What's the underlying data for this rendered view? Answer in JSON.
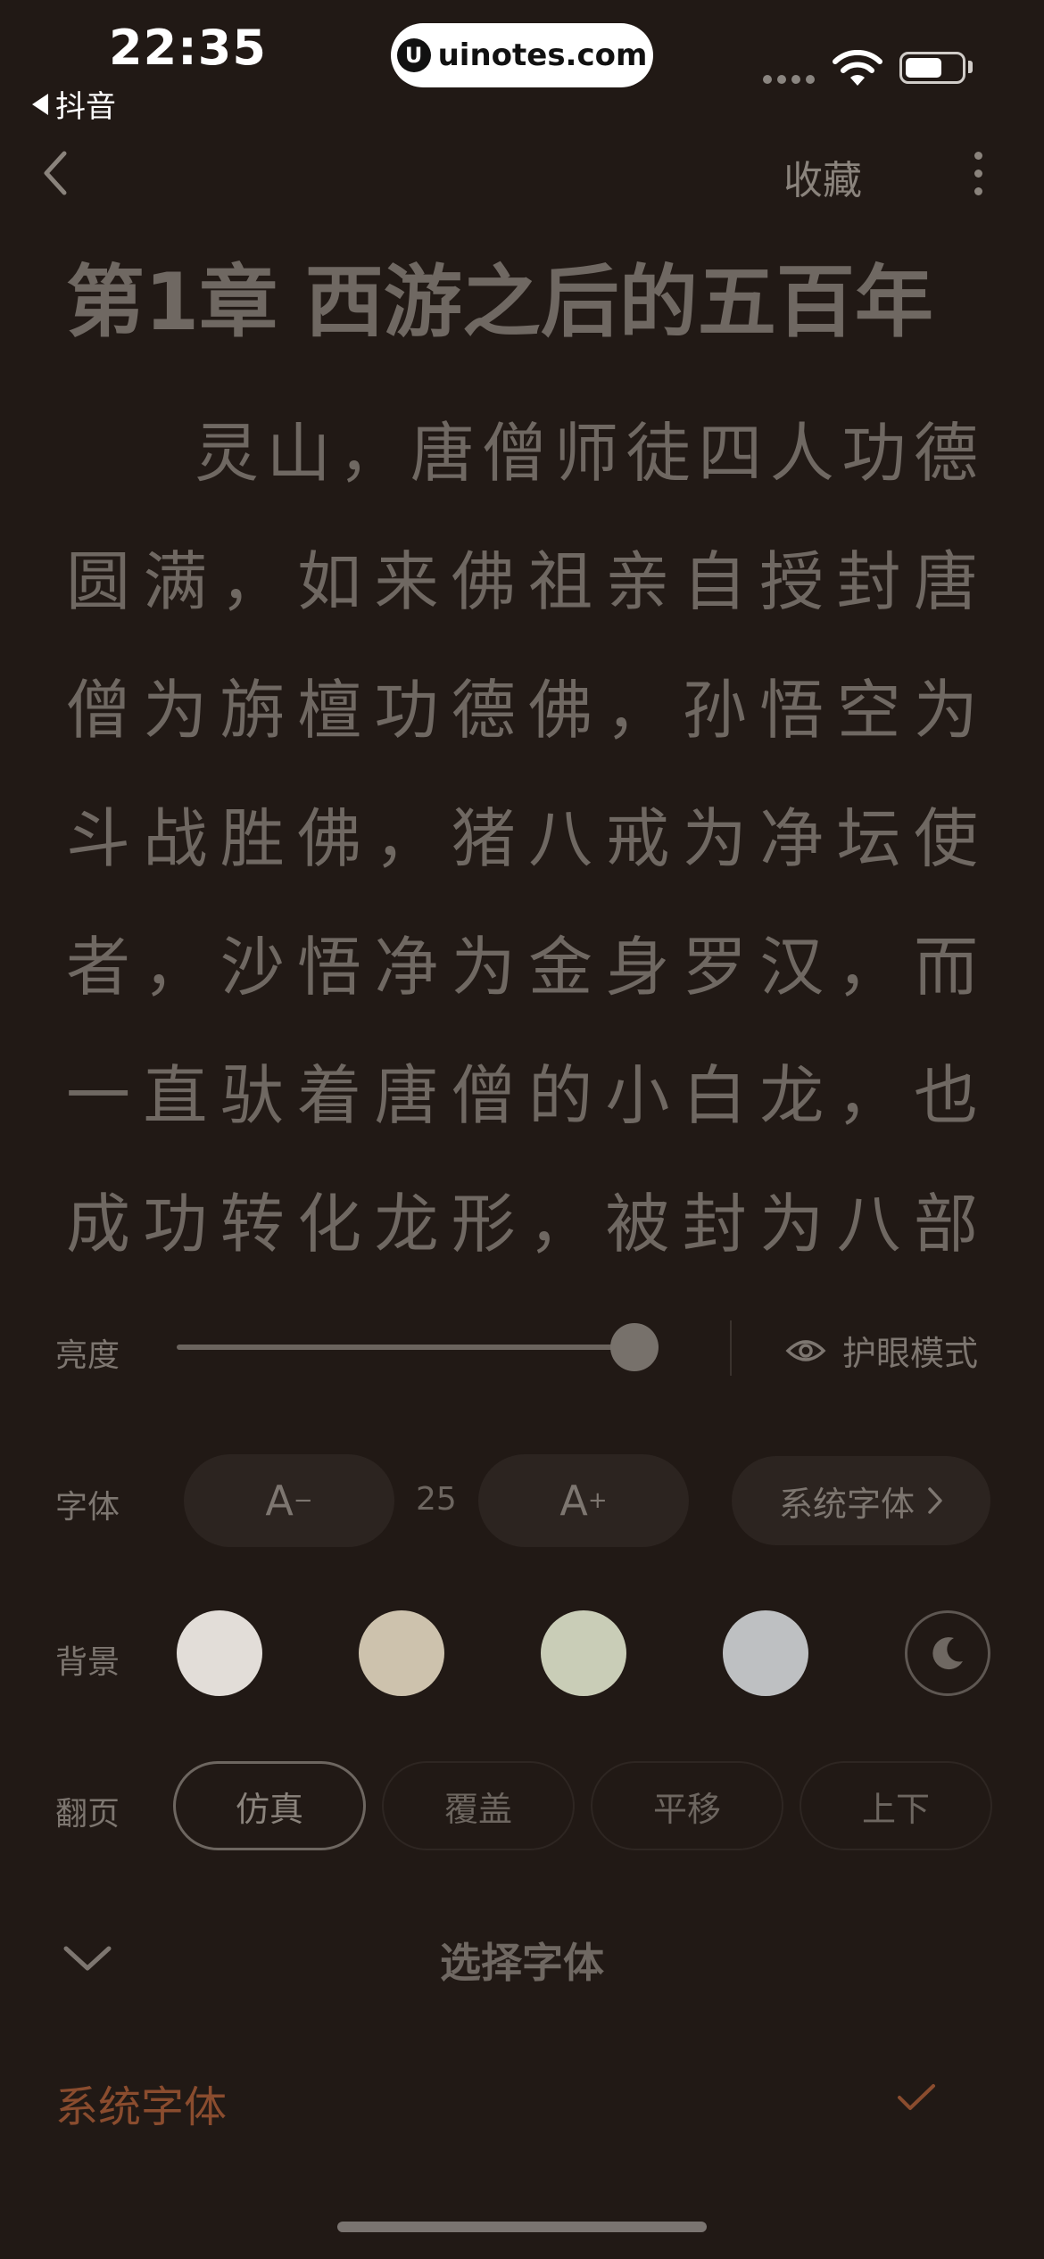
{
  "status_bar": {
    "time": "22:35",
    "back_app": "抖音",
    "watermark": "uinotes.com",
    "watermark_logo": "U"
  },
  "header": {
    "back_icon": "chevron-left-icon",
    "collect_label": "收藏",
    "more_icon": "more-vertical-icon"
  },
  "content": {
    "chapter_title": "第1章 西游之后的五百年",
    "paragraph": "灵山，唐僧师徒四人功德圆满，如来佛祖亲自授封唐僧为旃檀功德佛，孙悟空为斗战胜佛，猪八戒为净坛使者，沙悟净为金身罗汉，而一直驮着唐僧的小白龙，也成功转化龙形，被封为八部天龙广利菩"
  },
  "settings": {
    "brightness": {
      "label": "亮度",
      "level": 0.95,
      "eye_mode_label": "护眼模式"
    },
    "font": {
      "label": "字体",
      "decrease_label": "A",
      "decrease_mark": "−",
      "size": "25",
      "increase_label": "A",
      "increase_mark": "+",
      "system_font_label": "系统字体"
    },
    "background": {
      "label": "背景",
      "swatches": [
        "#e2ddd8",
        "#cdc2ad",
        "#c9cdb7",
        "#bec0c2"
      ],
      "night_icon": "moon-icon"
    },
    "page_turn": {
      "label": "翻页",
      "options": [
        "仿真",
        "覆盖",
        "平移",
        "上下"
      ],
      "selected": "仿真"
    }
  },
  "font_picker": {
    "title": "选择字体",
    "items": [
      {
        "label": "系统字体",
        "selected": true
      }
    ],
    "accent_color": "#8a4c2e"
  }
}
